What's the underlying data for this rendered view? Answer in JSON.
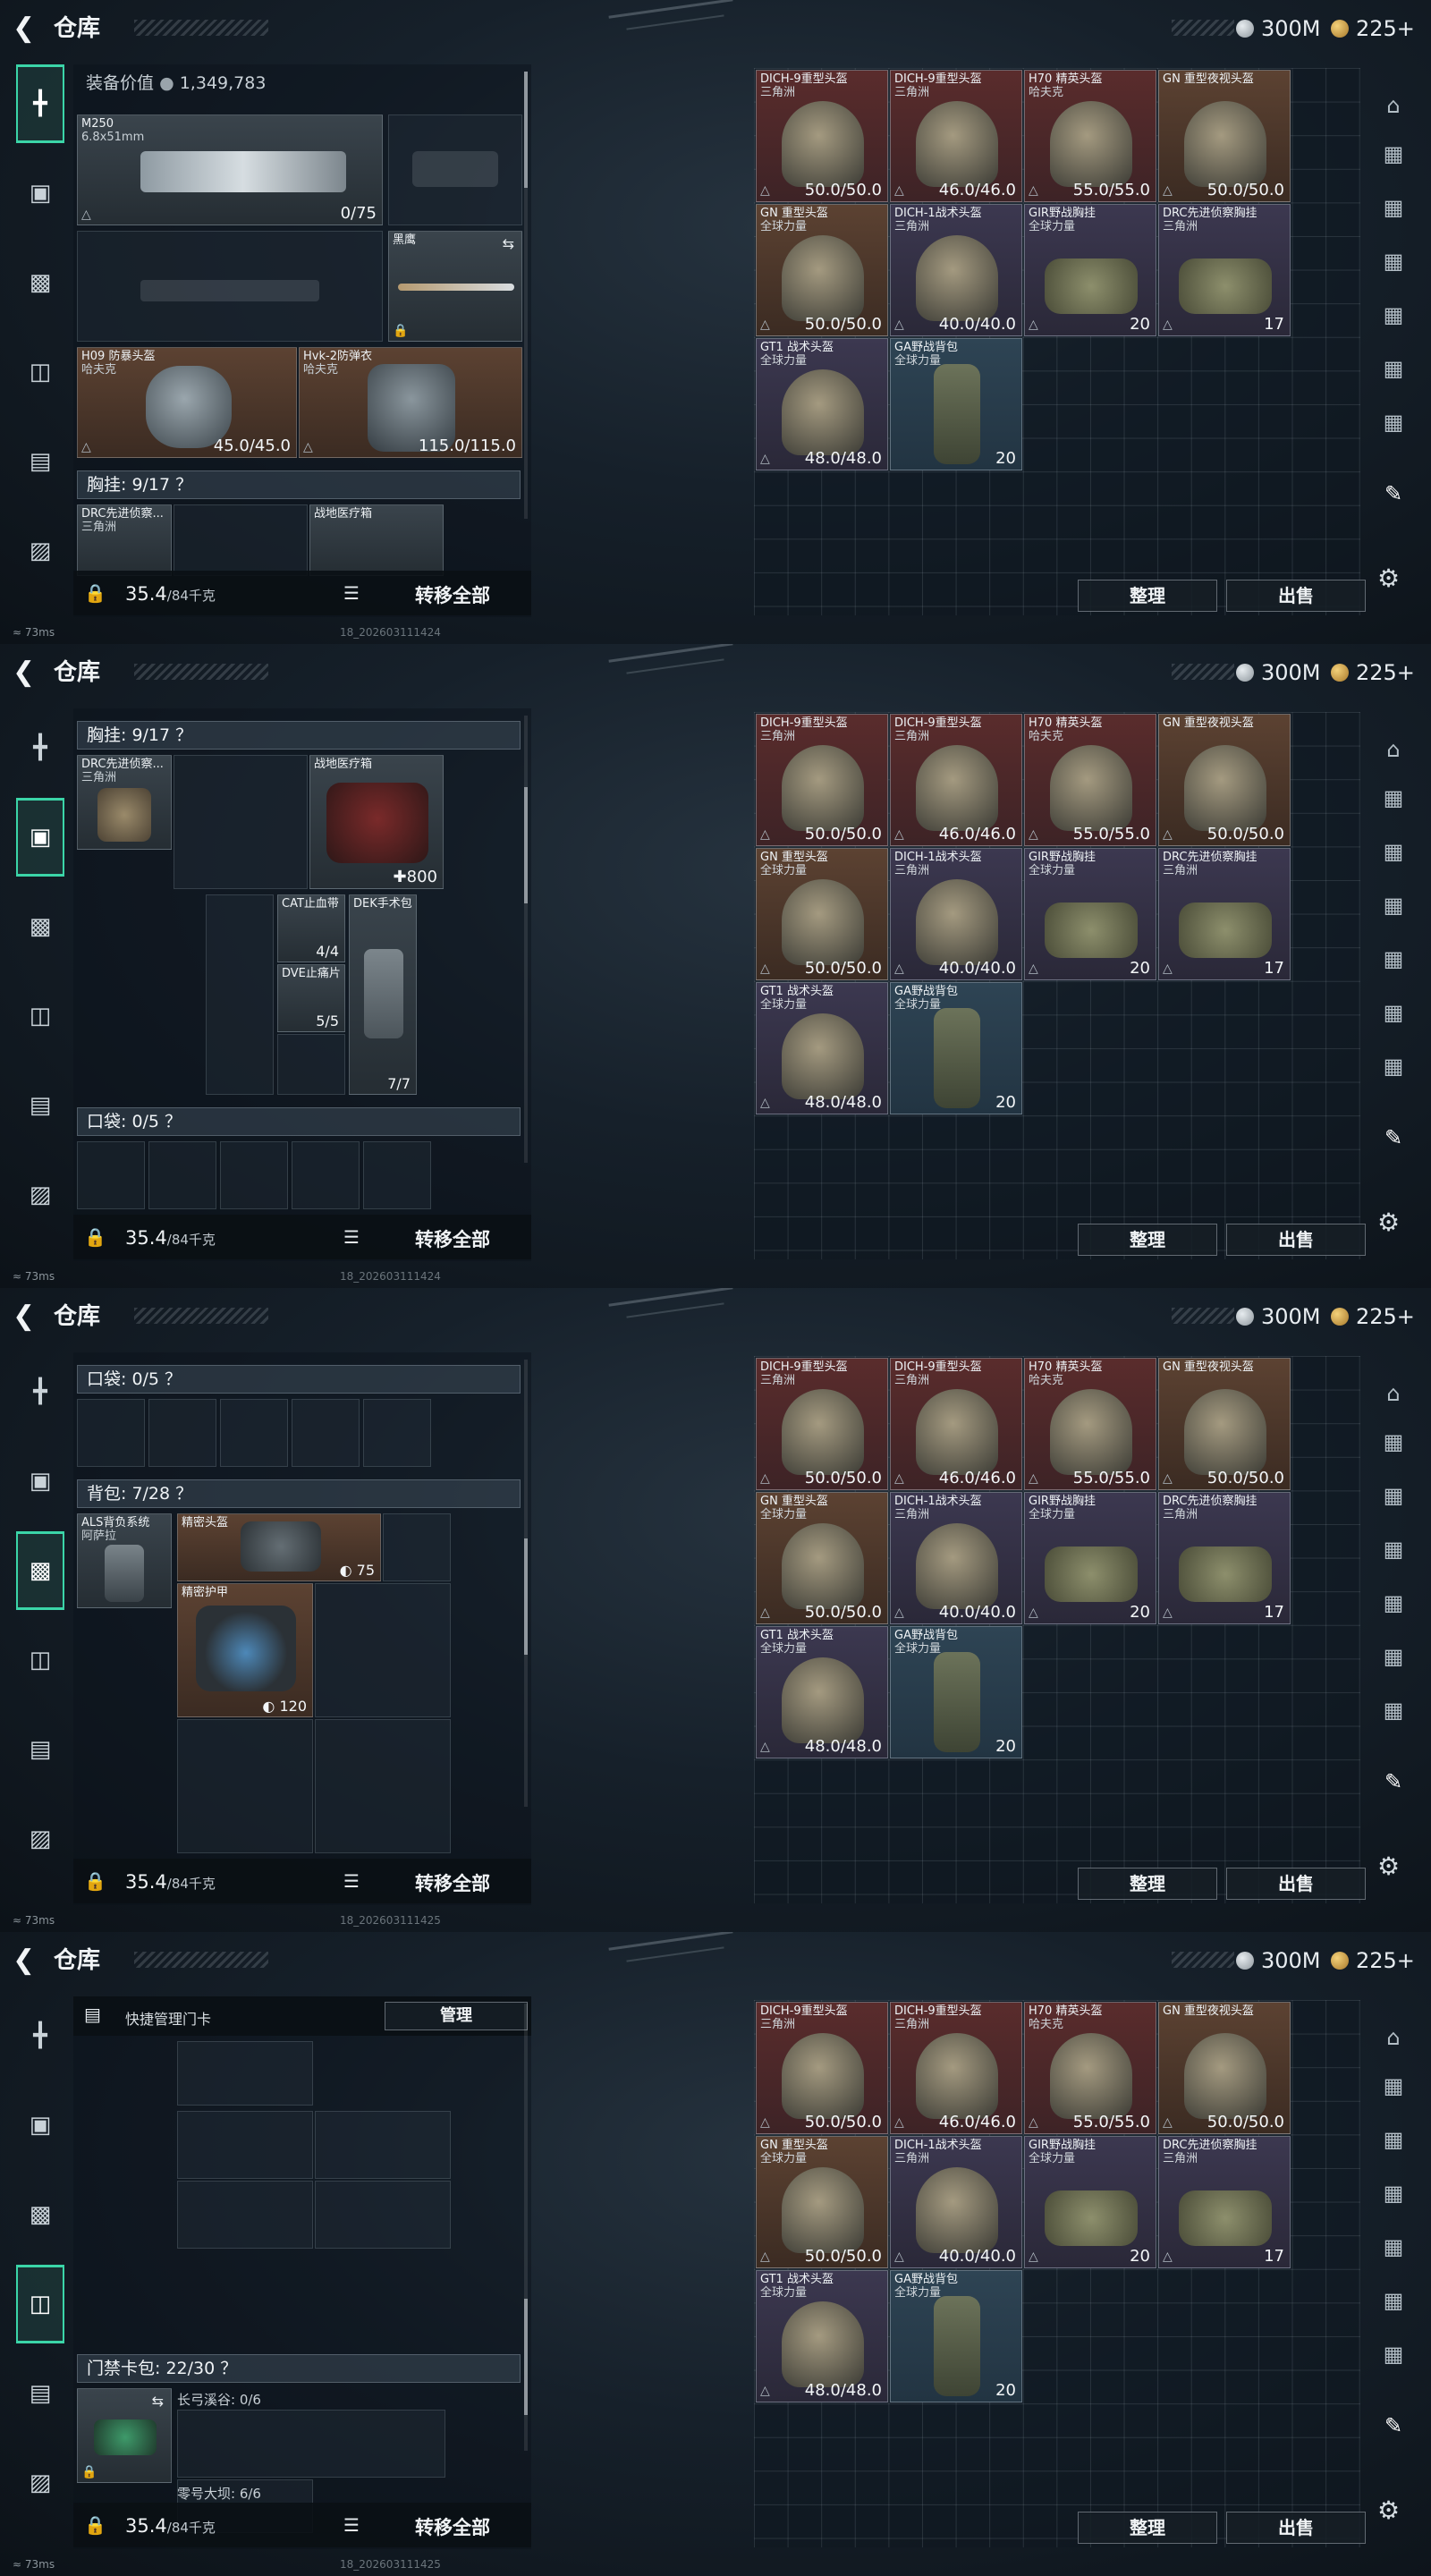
{
  "app": {
    "title": "仓库",
    "silver": "300M",
    "gold": "225+"
  },
  "sidebar": [
    "rifle-icon",
    "vest-icon",
    "backpack-icon",
    "keycard-bag-icon",
    "card-icon",
    "briefcase-icon"
  ],
  "bottom": {
    "weight": "35.4",
    "weight_unit": "/84千克",
    "transfer": "转移全部"
  },
  "status": {
    "ping": "73ms",
    "stamp1": "18_202603111424",
    "stamp2": "18_202603111425"
  },
  "panel1": {
    "value_label": "装备价值",
    "value": "1,349,783",
    "gun": {
      "name": "M250",
      "caliber": "6.8x51mm",
      "ammo": "0/75"
    },
    "knife": {
      "name": "黑鹰"
    },
    "helmet": {
      "name": "H09 防暴头盔",
      "sub": "哈夫克",
      "val": "45.0/45.0"
    },
    "armor": {
      "name": "Hvk-2防弹衣",
      "sub": "哈夫克",
      "val": "115.0/115.0"
    },
    "chest_label": "胸挂: 9/17 ？",
    "chest_item": {
      "name": "DRC先进侦察...",
      "sub": "三角洲"
    },
    "medbox": {
      "name": "战地医疗箱"
    }
  },
  "panel2": {
    "chest_label": "胸挂: 9/17 ？",
    "chest_item": {
      "name": "DRC先进侦察...",
      "sub": "三角洲"
    },
    "medbox": {
      "name": "战地医疗箱",
      "val": "800"
    },
    "cat": {
      "name": "CAT止血带",
      "val": "4/4"
    },
    "dve": {
      "name": "DVE止痛片",
      "val": "5/5"
    },
    "dek": {
      "name": "DEK手术包",
      "val": "7/7"
    },
    "pocket_label": "口袋: 0/5 ？"
  },
  "panel3": {
    "pocket_label": "口袋: 0/5 ？",
    "backpack_label": "背包: 7/28 ？",
    "als": {
      "name": "ALS背负系统",
      "sub": "阿萨拉"
    },
    "helmet_box": {
      "name": "精密头盔",
      "val": "75"
    },
    "armor_box": {
      "name": "精密护甲",
      "val": "120"
    }
  },
  "panel4": {
    "keycard_title": "快捷管理门卡",
    "manage": "管理",
    "bag_label": "门禁卡包: 22/30 ？",
    "long_bow": "长弓溪谷: 0/6",
    "zero_dam": "零号大坝: 6/6"
  },
  "stash": {
    "items": [
      {
        "name": "DICH-9重型头盔",
        "sub": "三角洲",
        "val": "50.0/50.0",
        "bg": "red"
      },
      {
        "name": "DICH-9重型头盔",
        "sub": "三角洲",
        "val": "46.0/46.0",
        "bg": "red"
      },
      {
        "name": "H70 精英头盔",
        "sub": "哈夫克",
        "val": "55.0/55.0",
        "bg": "red"
      },
      {
        "name": "GN 重型夜视头盔",
        "sub": "",
        "val": "50.0/50.0",
        "bg": "brown"
      },
      {
        "name": "GN 重型头盔",
        "sub": "全球力量",
        "val": "50.0/50.0",
        "bg": "brown"
      },
      {
        "name": "DICH-1战术头盔",
        "sub": "三角洲",
        "val": "40.0/40.0",
        "bg": "purple"
      },
      {
        "name": "GIR野战胸挂",
        "sub": "全球力量",
        "val": "20",
        "bg": "purple"
      },
      {
        "name": "DRC先进侦察胸挂",
        "sub": "三角洲",
        "val": "17",
        "bg": "purple"
      },
      {
        "name": "GT1 战术头盔",
        "sub": "全球力量",
        "val": "48.0/48.0",
        "bg": "purple"
      },
      {
        "name": "GA野战背包",
        "sub": "全球力量",
        "val": "20",
        "bg": "blue"
      }
    ],
    "sort": "整理",
    "sell": "出售"
  }
}
